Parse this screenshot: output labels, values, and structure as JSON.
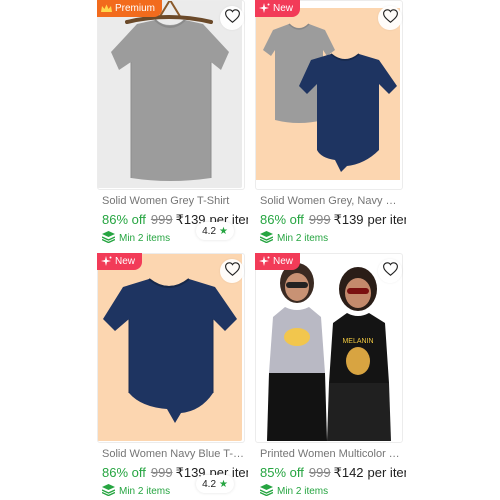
{
  "products": [
    {
      "badge": {
        "label": "Premium",
        "icon": "crown-icon"
      },
      "rating": {
        "value": "4.2",
        "icon": "star-icon"
      },
      "title": "Solid Women Grey T-Shirt",
      "discount": "86% off",
      "mrp": "999",
      "price": "₹139",
      "unit": "per item",
      "min_order": "Min 2 items"
    },
    {
      "badge": {
        "label": "New",
        "icon": "sparkle-icon"
      },
      "title": "Solid Women Grey, Navy Blue T-Shirt",
      "discount": "86% off",
      "mrp": "999",
      "price": "₹139",
      "unit": "per item",
      "min_order": "Min 2 items"
    },
    {
      "badge": {
        "label": "New",
        "icon": "sparkle-icon"
      },
      "rating": {
        "value": "4.2",
        "icon": "star-icon"
      },
      "title": "Solid Women Navy Blue T-Shirt",
      "discount": "86% off",
      "mrp": "999",
      "price": "₹139",
      "unit": "per item",
      "min_order": "Min 2 items"
    },
    {
      "badge": {
        "label": "New",
        "icon": "sparkle-icon"
      },
      "title": "Printed Women Multicolor T-Shirt",
      "discount": "85% off",
      "mrp": "999",
      "price": "₹142",
      "unit": "per item",
      "min_order": "Min 2 items",
      "print_text": "MELANIN"
    }
  ],
  "colors": {
    "premium_badge": "#f26b1d",
    "new_badge": "#f23b58",
    "discount_green": "#26a541",
    "grey_bg": "#ebebeb",
    "peach_bg": "#fcd6b0",
    "navy_shirt": "#1e3461",
    "grey_shirt": "#9c9c9c"
  }
}
